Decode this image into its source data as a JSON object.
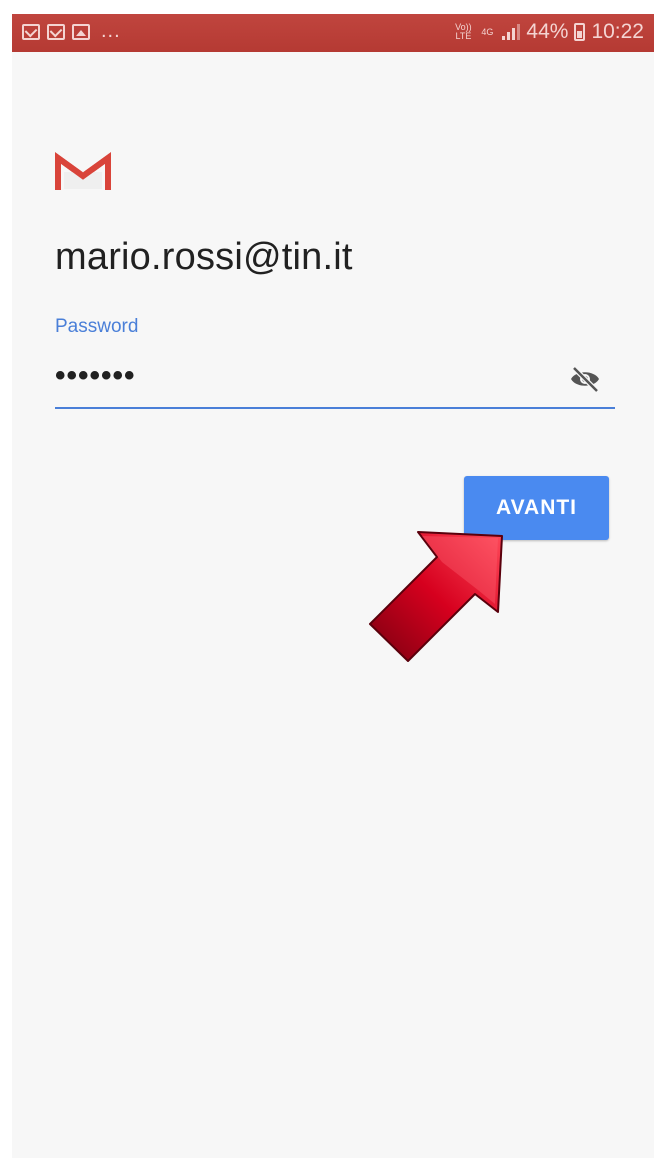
{
  "status_bar": {
    "more": "...",
    "volte": "Vo)) LTE",
    "network": "4G",
    "battery": "44%",
    "time": "10:22"
  },
  "login": {
    "email": "mario.rossi@tin.it",
    "password_label": "Password",
    "password_value": "•••••••",
    "next_button": "AVANTI"
  },
  "colors": {
    "status_bar": "#b53a33",
    "accent": "#4a7fd8",
    "button": "#4a8af0",
    "gmail_red": "#d9443a",
    "arrow": "#c0001a"
  },
  "icons": [
    "gmail-icon",
    "eye-off-icon",
    "mail-notification-icon",
    "image-notification-icon",
    "signal-icon",
    "battery-icon",
    "arrow-pointer-icon"
  ]
}
